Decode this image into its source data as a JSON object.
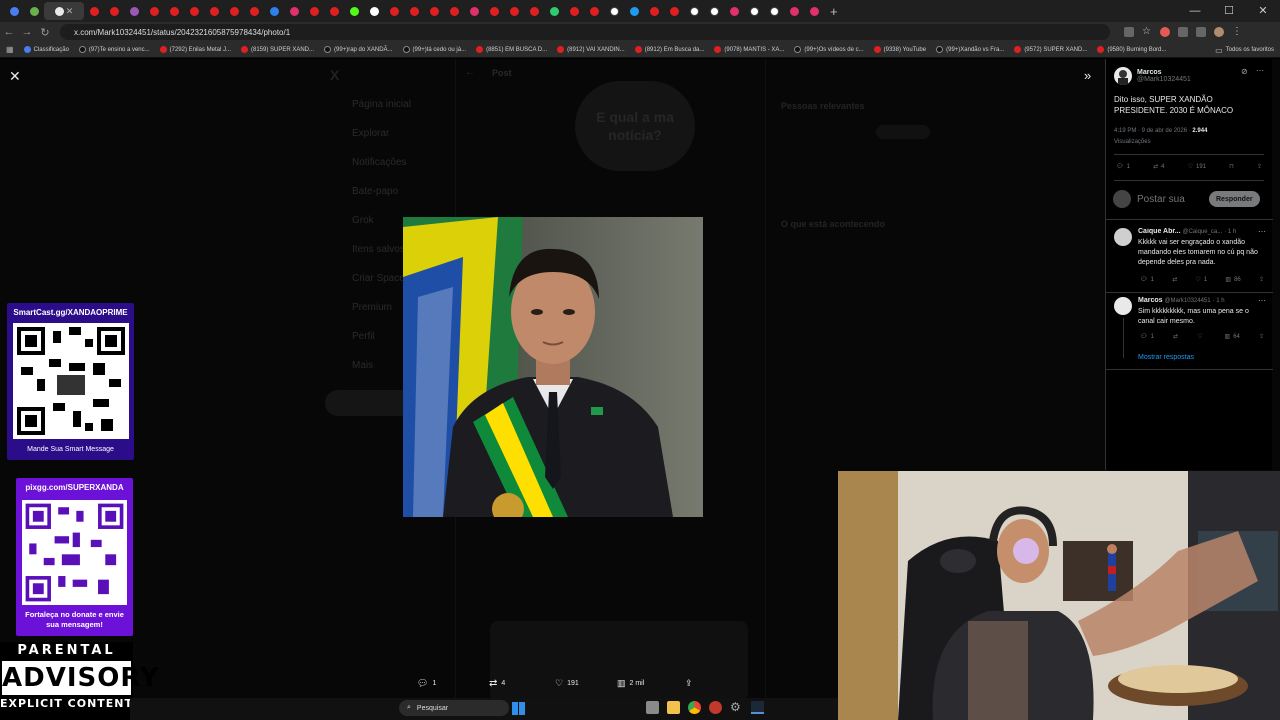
{
  "browser": {
    "url": "x.com/Mark10324451/status/2042321605875978434/photo/1",
    "bookmarks": [
      {
        "label": "Classificação",
        "kind": "blue"
      },
      {
        "label": "(97)Te ensino a venc...",
        "kind": "tk"
      },
      {
        "label": "(7292) Enilas Metal J...",
        "kind": "yt"
      },
      {
        "label": "(8159) SUPER XAND...",
        "kind": "yt"
      },
      {
        "label": "(99+)rap do XANDÃ...",
        "kind": "tk"
      },
      {
        "label": "(99+)tá cedo ou já...",
        "kind": "tk"
      },
      {
        "label": "(8851) EM BUSCA D...",
        "kind": "yt"
      },
      {
        "label": "(8912) VAI XANDIN...",
        "kind": "yt"
      },
      {
        "label": "(8912) Em Busca da...",
        "kind": "yt"
      },
      {
        "label": "(9078) MANTIS - XA...",
        "kind": "yt"
      },
      {
        "label": "(99+)Os vídeos de c...",
        "kind": "tk"
      },
      {
        "label": "(9338) YouTube",
        "kind": "yt"
      },
      {
        "label": "(99+)Xandão vs Fra...",
        "kind": "tk"
      },
      {
        "label": "(9572) SUPER XAND...",
        "kind": "yt"
      },
      {
        "label": "(9580) Burning Bord...",
        "kind": "yt"
      }
    ],
    "all_favorites": "Todos os favoritos"
  },
  "background": {
    "nav": [
      "Página inicial",
      "Explorar",
      "Notificações",
      "Bate-papo",
      "Grok",
      "Itens salvos",
      "Criar Spaces",
      "Premium",
      "Perfil",
      "Mais"
    ],
    "bubble": "E qual a ma notícia?",
    "relevant_people": "Pessoas relevantes",
    "whats_happening": "O que está acontecendo"
  },
  "viewer": {
    "actions": {
      "replies": "1",
      "reposts": "4",
      "likes": "191",
      "views": "2 mil"
    }
  },
  "post": {
    "author_name": "Marcos",
    "author_handle": "@Mark10324451",
    "text": "Dito isso, SUPER XANDÃO PRESIDENTE. 2030 É MÔNACO",
    "time": "4:19 PM · 9 de abr de 2026 ·",
    "views_count": "2.944",
    "views_label": "Visualizações",
    "stats": {
      "replies": "1",
      "reposts": "4",
      "likes": "191"
    },
    "reply_placeholder": "Postar sua",
    "reply_button": "Responder"
  },
  "replies": [
    {
      "name": "Caique Abr...",
      "handle": "@Caique_ca...",
      "time": "· 1 h",
      "text": "Kkkkk vai ser engraçado o xandão mandando eles tomarem no cú pq não depende deles pra nada.",
      "replies": "1",
      "likes": "1",
      "views": "86"
    },
    {
      "name": "Marcos",
      "handle": "@Mark10324451",
      "time": "· 1 h",
      "text": "Sim kkkkkkkkk, mas uma pena se o canal cair mesmo.",
      "replies": "1",
      "likes": "",
      "views": "64"
    }
  ],
  "show_replies": "Mostrar respostas",
  "overlays": {
    "smartcast_url": "SmartCast.gg/XANDAOPRIME",
    "smartcast_caption": "Mande Sua Smart Message",
    "pixgg_url": "pixgg.com/SUPERXANDA",
    "pixgg_caption": "Fortaleça no donate e envie sua mensagem!",
    "advisory_line1": "PARENTAL",
    "advisory_line2": "ADVISORY",
    "advisory_line3": "EXPLICIT CONTENT"
  },
  "taskbar": {
    "search_label": "Pesquisar"
  },
  "colors": {
    "accent": "#1d9bf0",
    "smartcast_bg": "#2b0d8a",
    "pixgg_bg": "#6c12d8",
    "brazil_green": "#009b3a",
    "brazil_yellow": "#fedf00"
  }
}
